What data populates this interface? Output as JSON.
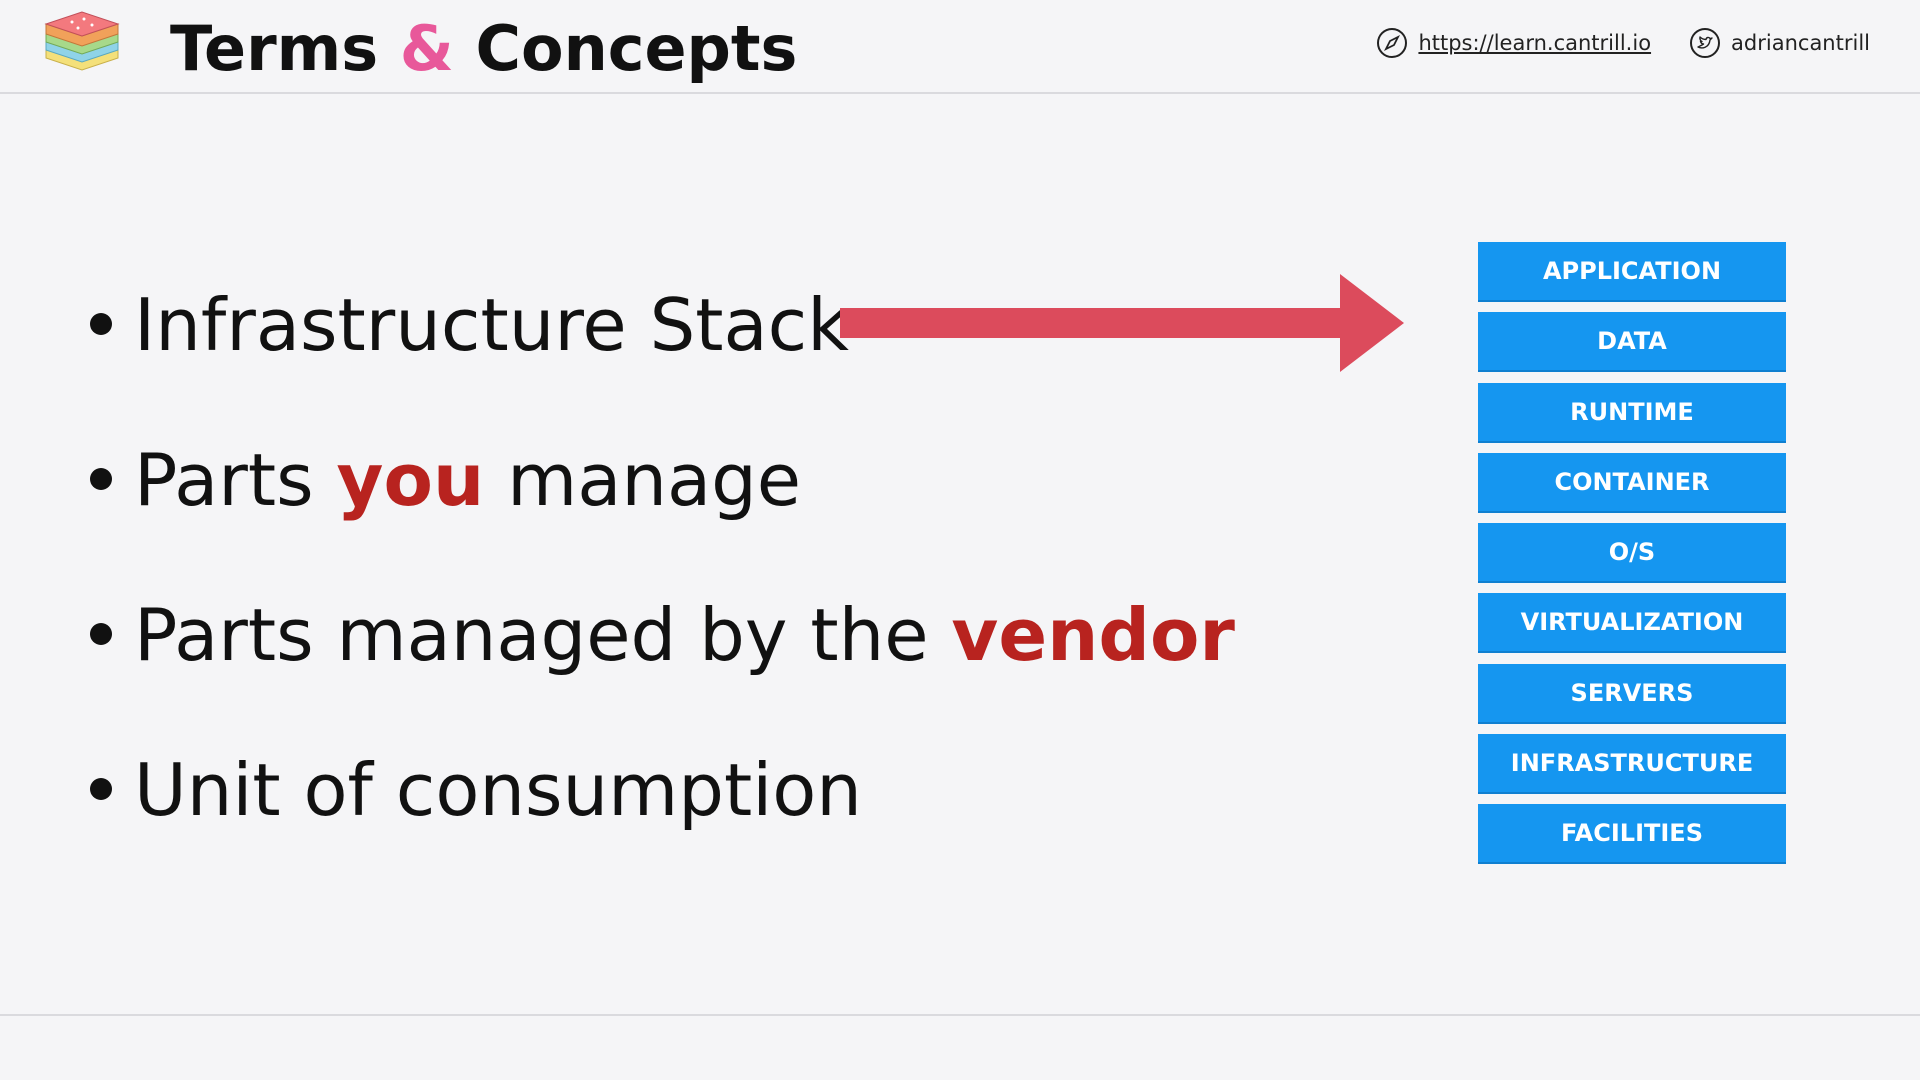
{
  "header": {
    "title_part1": "Terms",
    "title_amp": "&",
    "title_part2": "Concepts",
    "website": "https://learn.cantrill.io",
    "twitter": "adriancantrill",
    "logo_icon": "layered-stack-logo-icon",
    "website_icon": "compass-icon",
    "twitter_icon": "twitter-bird-icon"
  },
  "bullets": {
    "item1": "Infrastructure Stack",
    "item2_pre": "Parts ",
    "item2_hl": "you",
    "item2_post": " manage",
    "item3_pre": "Parts managed by the ",
    "item3_hl": "vendor",
    "item4": "Unit of consumption"
  },
  "stack": {
    "layers": [
      "APPLICATION",
      "DATA",
      "RUNTIME",
      "CONTAINER",
      "O/S",
      "VIRTUALIZATION",
      "SERVERS",
      "INFRASTRUCTURE",
      "FACILITIES"
    ]
  },
  "colors": {
    "accent_pink": "#e8589a",
    "highlight_red": "#b8231f",
    "arrow_red": "#dc4b5c",
    "layer_blue": "#1596f0"
  }
}
